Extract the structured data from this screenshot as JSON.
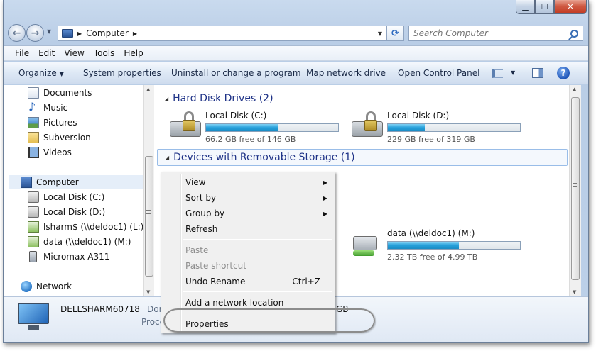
{
  "window": {
    "caption": {
      "minimize": "▁",
      "maximize": "☐",
      "close": "✕"
    }
  },
  "address_bar": {
    "path": "Computer",
    "search_placeholder": "Search Computer"
  },
  "menu_bar": [
    "File",
    "Edit",
    "View",
    "Tools",
    "Help"
  ],
  "command_bar": {
    "organize": "Organize",
    "system_properties": "System properties",
    "uninstall": "Uninstall or change a program",
    "map_drive": "Map network drive",
    "control_panel": "Open Control Panel",
    "help": "?"
  },
  "nav_pane": {
    "libraries": [
      "Documents",
      "Music",
      "Pictures",
      "Subversion",
      "Videos"
    ],
    "computer": "Computer",
    "computer_children": [
      "Local Disk (C:)",
      "Local Disk (D:)",
      "lsharm$ (\\\\deldoc1) (L:)",
      "data (\\\\deldoc1) (M:)",
      "Micromax A311"
    ],
    "network": "Network"
  },
  "content": {
    "groups": {
      "hard_disks": "Hard Disk Drives (2)",
      "removable": "Devices with Removable Storage (1)"
    },
    "drives": [
      {
        "name": "Local Disk (C:)",
        "free": "66.2 GB free of 146 GB",
        "used_fraction": 0.55
      },
      {
        "name": "Local Disk (D:)",
        "free": "229 GB free of 319 GB",
        "used_fraction": 0.28
      },
      {
        "name": "data (\\\\deldoc1) (M:)",
        "free": "2.32 TB free of 4.99 TB",
        "used_fraction": 0.54
      }
    ]
  },
  "details_pane": {
    "computer_name": "DELLSHARM60718",
    "label1": "Dor",
    "label2": "Proce",
    "value": "GB"
  },
  "context_menu": {
    "view": "View",
    "sort_by": "Sort by",
    "group_by": "Group by",
    "refresh": "Refresh",
    "paste": "Paste",
    "paste_shortcut": "Paste shortcut",
    "undo_rename": "Undo Rename",
    "undo_shortcut": "Ctrl+Z",
    "add_network_location": "Add a network location",
    "properties": "Properties"
  },
  "colors": {
    "drive_bar": "#26a0da",
    "group_header_text": "#1e3287"
  }
}
